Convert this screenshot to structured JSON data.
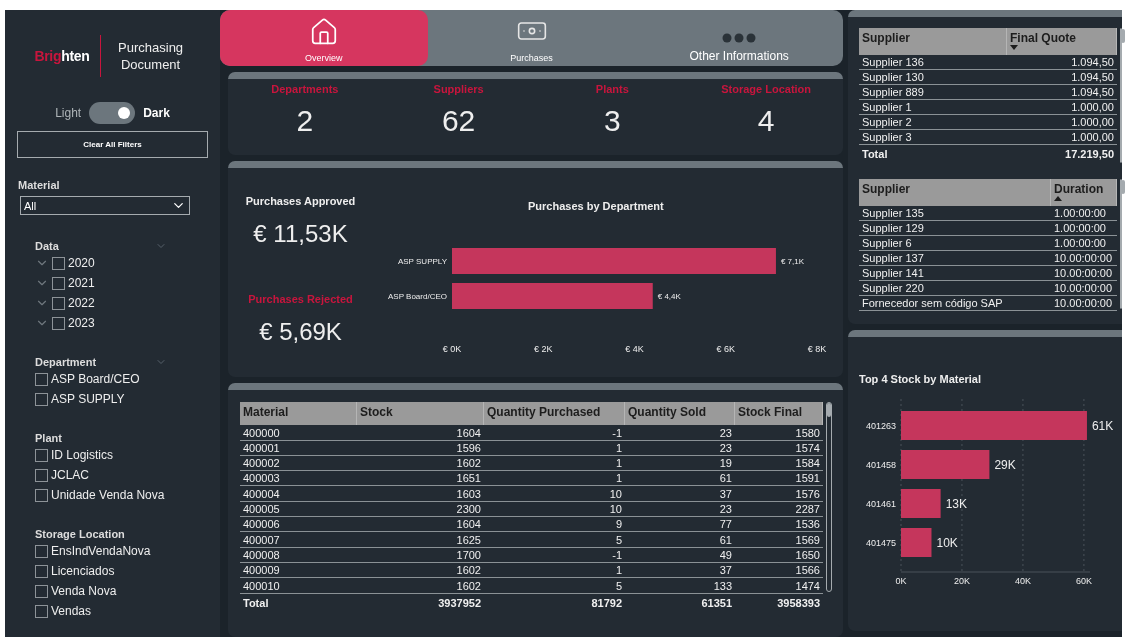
{
  "brand": {
    "accent": "Brig",
    "rest": "hten"
  },
  "document_title": "Purchasing Document",
  "theme_toggle": {
    "off_label": "Light",
    "on_label": "Dark",
    "on": true
  },
  "clear_button": "Clear All Filters",
  "material_filter": {
    "label": "Material",
    "value": "All"
  },
  "slicers": [
    {
      "title": "Data",
      "kind": "hierarchy",
      "header_chevron": true,
      "items": [
        {
          "label": "2020",
          "checked": false
        },
        {
          "label": "2021",
          "checked": false
        },
        {
          "label": "2022",
          "checked": false
        },
        {
          "label": "2023",
          "checked": false
        }
      ]
    },
    {
      "title": "Department",
      "kind": "list",
      "header_chevron": true,
      "items": [
        {
          "label": "ASP Board/CEO",
          "checked": false
        },
        {
          "label": "ASP SUPPLY",
          "checked": false
        }
      ]
    },
    {
      "title": "Plant",
      "kind": "list",
      "header_chevron": false,
      "items": [
        {
          "label": "ID Logistics",
          "checked": false
        },
        {
          "label": "JCLAC",
          "checked": false
        },
        {
          "label": "Unidade Venda Nova",
          "checked": false
        }
      ]
    },
    {
      "title": "Storage Location",
      "kind": "list",
      "header_chevron": false,
      "items": [
        {
          "label": "EnsIndVendaNova",
          "checked": false
        },
        {
          "label": "Licenciados",
          "checked": false
        },
        {
          "label": "Venda Nova",
          "checked": false
        },
        {
          "label": "Vendas",
          "checked": false
        }
      ]
    }
  ],
  "tabs": [
    {
      "label": "Overview",
      "kind": "home",
      "selected": true
    },
    {
      "label": "Purchases",
      "kind": "money",
      "selected": false
    },
    {
      "label": "Other Informations",
      "kind": "more",
      "selected": false
    }
  ],
  "kpis": [
    {
      "label": "Departments",
      "value": "2"
    },
    {
      "label": "Suppliers",
      "value": "62"
    },
    {
      "label": "Plants",
      "value": "3"
    },
    {
      "label": "Storage Location",
      "value": "4"
    }
  ],
  "purchases_approved": {
    "label": "Purchases Approved",
    "value": "€ 11,53K"
  },
  "purchases_rejected": {
    "label": "Purchases Rejected",
    "value": "€ 5,69K"
  },
  "department_chart": {
    "chart_data": {
      "type": "bar",
      "orientation": "horizontal",
      "title": "Purchases by Department",
      "categories": [
        "ASP SUPPLY",
        "ASP Board/CEO"
      ],
      "series": [
        {
          "color": "#c5365c",
          "values": [
            7100,
            4400
          ]
        }
      ],
      "value_labels": [
        "€ 7,1K",
        "€ 4,4K"
      ],
      "xlim": [
        0,
        8000
      ],
      "xticks": [
        {
          "value": 0,
          "label": "€ 0K"
        },
        {
          "value": 2000,
          "label": "€ 2K"
        },
        {
          "value": 4000,
          "label": "€ 4K"
        },
        {
          "value": 6000,
          "label": "€ 6K"
        },
        {
          "value": 8000,
          "label": "€ 8K"
        }
      ]
    }
  },
  "stock_table": {
    "columns": [
      {
        "label": "Material"
      },
      {
        "label": "Stock"
      },
      {
        "label": "Quantity Purchased"
      },
      {
        "label": "Quantity Sold"
      },
      {
        "label": "Stock Final"
      }
    ],
    "rows": [
      [
        "400000",
        "1604",
        "-1",
        "23",
        "1580"
      ],
      [
        "400001",
        "1596",
        "1",
        "23",
        "1574"
      ],
      [
        "400002",
        "1602",
        "1",
        "19",
        "1584"
      ],
      [
        "400003",
        "1651",
        "1",
        "61",
        "1591"
      ],
      [
        "400004",
        "1603",
        "10",
        "37",
        "1576"
      ],
      [
        "400005",
        "2300",
        "10",
        "23",
        "2287"
      ],
      [
        "400006",
        "1604",
        "9",
        "77",
        "1536"
      ],
      [
        "400007",
        "1625",
        "5",
        "61",
        "1569"
      ],
      [
        "400008",
        "1700",
        "-1",
        "49",
        "1650"
      ],
      [
        "400009",
        "1602",
        "1",
        "37",
        "1566"
      ],
      [
        "400010",
        "1602",
        "5",
        "133",
        "1474"
      ]
    ],
    "total": [
      "Total",
      "3937952",
      "81792",
      "61351",
      "3958393"
    ]
  },
  "quote_table": {
    "columns": [
      {
        "label": "Supplier"
      },
      {
        "label": "Final Quote",
        "sort_descending": true
      }
    ],
    "rows": [
      [
        "Supplier 136",
        "1.094,50"
      ],
      [
        "Supplier 130",
        "1.094,50"
      ],
      [
        "Supplier 889",
        "1.094,50"
      ],
      [
        "Supplier 1",
        "1.000,00"
      ],
      [
        "Supplier 2",
        "1.000,00"
      ],
      [
        "Supplier 3",
        "1.000,00"
      ]
    ],
    "total": [
      "Total",
      "17.219,50"
    ]
  },
  "duration_table": {
    "columns": [
      {
        "label": "Supplier"
      },
      {
        "label": "Duration",
        "sort_ascending": true
      }
    ],
    "rows": [
      [
        "Supplier 135",
        "1.00:00:00"
      ],
      [
        "Supplier 129",
        "1.00:00:00"
      ],
      [
        "Supplier 6",
        "1.00:00:00"
      ],
      [
        "Supplier 137",
        "10.00:00:00"
      ],
      [
        "Supplier 141",
        "10.00:00:00"
      ],
      [
        "Supplier 220",
        "10.00:00:00"
      ],
      [
        "Fornecedor sem código SAP",
        "10.00:00:00"
      ]
    ]
  },
  "stock_chart": {
    "chart_data": {
      "type": "bar",
      "orientation": "horizontal",
      "title": "Top 4 Stock by Material",
      "categories": [
        "401263",
        "401458",
        "401461",
        "401475"
      ],
      "series": [
        {
          "color": "#c5365c",
          "values": [
            61000,
            29000,
            13000,
            10000
          ]
        }
      ],
      "value_labels": [
        "61K",
        "29K",
        "13K",
        "10K"
      ],
      "grid": true,
      "xlim": [
        0,
        62000
      ],
      "xticks": [
        {
          "value": 0,
          "label": "0K"
        },
        {
          "value": 20000,
          "label": "20K"
        },
        {
          "value": 40000,
          "label": "40K"
        },
        {
          "value": 60000,
          "label": "60K"
        }
      ]
    }
  }
}
